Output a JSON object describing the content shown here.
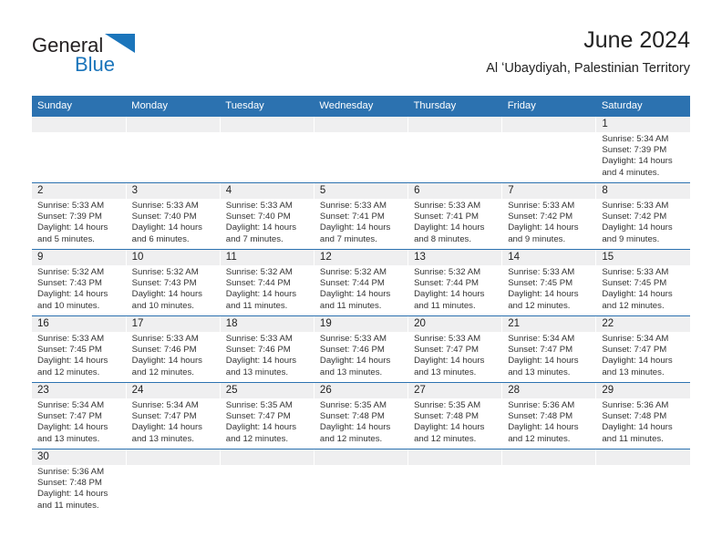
{
  "brand": {
    "word1": "General",
    "word2": "Blue",
    "logo_icon": "blue-triangle-flag-icon",
    "accent_color": "#1b75bb"
  },
  "header": {
    "title": "June 2024",
    "subtitle": "Al ʻUbaydiyah, Palestinian Territory"
  },
  "theme": {
    "header_blue": "#2c72b0",
    "daynum_gray": "#efeff0",
    "text_color": "#222222"
  },
  "weekdays": [
    "Sunday",
    "Monday",
    "Tuesday",
    "Wednesday",
    "Thursday",
    "Friday",
    "Saturday"
  ],
  "days": {
    "1": {
      "num": "1",
      "sunrise": "Sunrise: 5:34 AM",
      "sunset": "Sunset: 7:39 PM",
      "daylight1": "Daylight: 14 hours",
      "daylight2": "and 4 minutes."
    },
    "2": {
      "num": "2",
      "sunrise": "Sunrise: 5:33 AM",
      "sunset": "Sunset: 7:39 PM",
      "daylight1": "Daylight: 14 hours",
      "daylight2": "and 5 minutes."
    },
    "3": {
      "num": "3",
      "sunrise": "Sunrise: 5:33 AM",
      "sunset": "Sunset: 7:40 PM",
      "daylight1": "Daylight: 14 hours",
      "daylight2": "and 6 minutes."
    },
    "4": {
      "num": "4",
      "sunrise": "Sunrise: 5:33 AM",
      "sunset": "Sunset: 7:40 PM",
      "daylight1": "Daylight: 14 hours",
      "daylight2": "and 7 minutes."
    },
    "5": {
      "num": "5",
      "sunrise": "Sunrise: 5:33 AM",
      "sunset": "Sunset: 7:41 PM",
      "daylight1": "Daylight: 14 hours",
      "daylight2": "and 7 minutes."
    },
    "6": {
      "num": "6",
      "sunrise": "Sunrise: 5:33 AM",
      "sunset": "Sunset: 7:41 PM",
      "daylight1": "Daylight: 14 hours",
      "daylight2": "and 8 minutes."
    },
    "7": {
      "num": "7",
      "sunrise": "Sunrise: 5:33 AM",
      "sunset": "Sunset: 7:42 PM",
      "daylight1": "Daylight: 14 hours",
      "daylight2": "and 9 minutes."
    },
    "8": {
      "num": "8",
      "sunrise": "Sunrise: 5:33 AM",
      "sunset": "Sunset: 7:42 PM",
      "daylight1": "Daylight: 14 hours",
      "daylight2": "and 9 minutes."
    },
    "9": {
      "num": "9",
      "sunrise": "Sunrise: 5:32 AM",
      "sunset": "Sunset: 7:43 PM",
      "daylight1": "Daylight: 14 hours",
      "daylight2": "and 10 minutes."
    },
    "10": {
      "num": "10",
      "sunrise": "Sunrise: 5:32 AM",
      "sunset": "Sunset: 7:43 PM",
      "daylight1": "Daylight: 14 hours",
      "daylight2": "and 10 minutes."
    },
    "11": {
      "num": "11",
      "sunrise": "Sunrise: 5:32 AM",
      "sunset": "Sunset: 7:44 PM",
      "daylight1": "Daylight: 14 hours",
      "daylight2": "and 11 minutes."
    },
    "12": {
      "num": "12",
      "sunrise": "Sunrise: 5:32 AM",
      "sunset": "Sunset: 7:44 PM",
      "daylight1": "Daylight: 14 hours",
      "daylight2": "and 11 minutes."
    },
    "13": {
      "num": "13",
      "sunrise": "Sunrise: 5:32 AM",
      "sunset": "Sunset: 7:44 PM",
      "daylight1": "Daylight: 14 hours",
      "daylight2": "and 11 minutes."
    },
    "14": {
      "num": "14",
      "sunrise": "Sunrise: 5:33 AM",
      "sunset": "Sunset: 7:45 PM",
      "daylight1": "Daylight: 14 hours",
      "daylight2": "and 12 minutes."
    },
    "15": {
      "num": "15",
      "sunrise": "Sunrise: 5:33 AM",
      "sunset": "Sunset: 7:45 PM",
      "daylight1": "Daylight: 14 hours",
      "daylight2": "and 12 minutes."
    },
    "16": {
      "num": "16",
      "sunrise": "Sunrise: 5:33 AM",
      "sunset": "Sunset: 7:45 PM",
      "daylight1": "Daylight: 14 hours",
      "daylight2": "and 12 minutes."
    },
    "17": {
      "num": "17",
      "sunrise": "Sunrise: 5:33 AM",
      "sunset": "Sunset: 7:46 PM",
      "daylight1": "Daylight: 14 hours",
      "daylight2": "and 12 minutes."
    },
    "18": {
      "num": "18",
      "sunrise": "Sunrise: 5:33 AM",
      "sunset": "Sunset: 7:46 PM",
      "daylight1": "Daylight: 14 hours",
      "daylight2": "and 13 minutes."
    },
    "19": {
      "num": "19",
      "sunrise": "Sunrise: 5:33 AM",
      "sunset": "Sunset: 7:46 PM",
      "daylight1": "Daylight: 14 hours",
      "daylight2": "and 13 minutes."
    },
    "20": {
      "num": "20",
      "sunrise": "Sunrise: 5:33 AM",
      "sunset": "Sunset: 7:47 PM",
      "daylight1": "Daylight: 14 hours",
      "daylight2": "and 13 minutes."
    },
    "21": {
      "num": "21",
      "sunrise": "Sunrise: 5:34 AM",
      "sunset": "Sunset: 7:47 PM",
      "daylight1": "Daylight: 14 hours",
      "daylight2": "and 13 minutes."
    },
    "22": {
      "num": "22",
      "sunrise": "Sunrise: 5:34 AM",
      "sunset": "Sunset: 7:47 PM",
      "daylight1": "Daylight: 14 hours",
      "daylight2": "and 13 minutes."
    },
    "23": {
      "num": "23",
      "sunrise": "Sunrise: 5:34 AM",
      "sunset": "Sunset: 7:47 PM",
      "daylight1": "Daylight: 14 hours",
      "daylight2": "and 13 minutes."
    },
    "24": {
      "num": "24",
      "sunrise": "Sunrise: 5:34 AM",
      "sunset": "Sunset: 7:47 PM",
      "daylight1": "Daylight: 14 hours",
      "daylight2": "and 13 minutes."
    },
    "25": {
      "num": "25",
      "sunrise": "Sunrise: 5:35 AM",
      "sunset": "Sunset: 7:47 PM",
      "daylight1": "Daylight: 14 hours",
      "daylight2": "and 12 minutes."
    },
    "26": {
      "num": "26",
      "sunrise": "Sunrise: 5:35 AM",
      "sunset": "Sunset: 7:48 PM",
      "daylight1": "Daylight: 14 hours",
      "daylight2": "and 12 minutes."
    },
    "27": {
      "num": "27",
      "sunrise": "Sunrise: 5:35 AM",
      "sunset": "Sunset: 7:48 PM",
      "daylight1": "Daylight: 14 hours",
      "daylight2": "and 12 minutes."
    },
    "28": {
      "num": "28",
      "sunrise": "Sunrise: 5:36 AM",
      "sunset": "Sunset: 7:48 PM",
      "daylight1": "Daylight: 14 hours",
      "daylight2": "and 12 minutes."
    },
    "29": {
      "num": "29",
      "sunrise": "Sunrise: 5:36 AM",
      "sunset": "Sunset: 7:48 PM",
      "daylight1": "Daylight: 14 hours",
      "daylight2": "and 11 minutes."
    },
    "30": {
      "num": "30",
      "sunrise": "Sunrise: 5:36 AM",
      "sunset": "Sunset: 7:48 PM",
      "daylight1": "Daylight: 14 hours",
      "daylight2": "and 11 minutes."
    }
  }
}
